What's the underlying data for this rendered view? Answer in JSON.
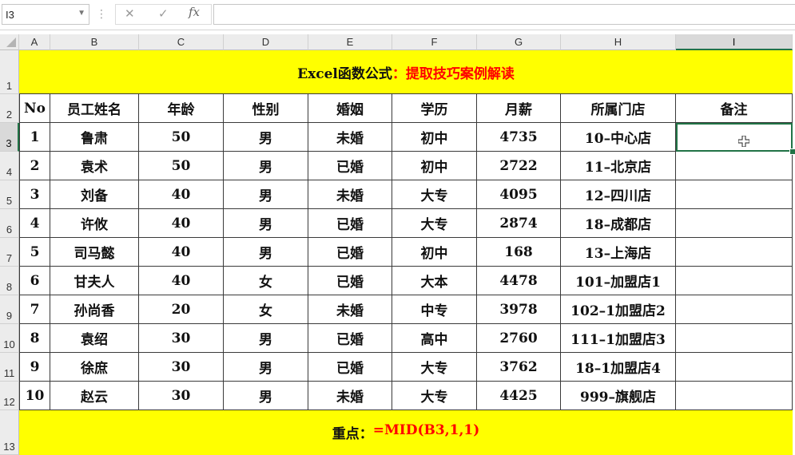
{
  "formula_bar": {
    "name_box": "I3",
    "cancel_icon": "✕",
    "enter_icon": "✓",
    "fx_label": "fx",
    "formula": ""
  },
  "columns": [
    "A",
    "B",
    "C",
    "D",
    "E",
    "F",
    "G",
    "H",
    "I"
  ],
  "rows": [
    "1",
    "2",
    "3",
    "4",
    "5",
    "6",
    "7",
    "8",
    "9",
    "10",
    "11",
    "12",
    "13"
  ],
  "selected_cell": "I3",
  "title": {
    "prefix": "Excel函数公式",
    "suffix": "：提取技巧案例解读"
  },
  "headers": [
    "No",
    "员工姓名",
    "年龄",
    "性别",
    "婚姻",
    "学历",
    "月薪",
    "所属门店",
    "备注"
  ],
  "table": [
    [
      "1",
      "鲁肃",
      "50",
      "男",
      "未婚",
      "初中",
      "4735",
      "10–中心店",
      ""
    ],
    [
      "2",
      "袁术",
      "50",
      "男",
      "已婚",
      "初中",
      "2722",
      "11–北京店",
      ""
    ],
    [
      "3",
      "刘备",
      "40",
      "男",
      "未婚",
      "大专",
      "4095",
      "12–四川店",
      ""
    ],
    [
      "4",
      "许攸",
      "40",
      "男",
      "已婚",
      "大专",
      "2874",
      "18–成都店",
      ""
    ],
    [
      "5",
      "司马懿",
      "40",
      "男",
      "已婚",
      "初中",
      "168",
      "13–上海店",
      ""
    ],
    [
      "6",
      "甘夫人",
      "40",
      "女",
      "已婚",
      "大本",
      "4478",
      "101–加盟店1",
      ""
    ],
    [
      "7",
      "孙尚香",
      "20",
      "女",
      "未婚",
      "中专",
      "3978",
      "102–1加盟店2",
      ""
    ],
    [
      "8",
      "袁绍",
      "30",
      "男",
      "已婚",
      "高中",
      "2760",
      "111–1加盟店3",
      ""
    ],
    [
      "9",
      "徐庶",
      "30",
      "男",
      "已婚",
      "大专",
      "3762",
      "18–1加盟店4",
      ""
    ],
    [
      "10",
      "赵云",
      "30",
      "男",
      "未婚",
      "大专",
      "4425",
      "999–旗舰店",
      ""
    ]
  ],
  "footer": {
    "label": "重点：",
    "formula": "=MID(B3,1,1)"
  },
  "colors": {
    "highlight": "#ffff00",
    "accent_red": "#ff0000",
    "selection_green": "#217346"
  }
}
